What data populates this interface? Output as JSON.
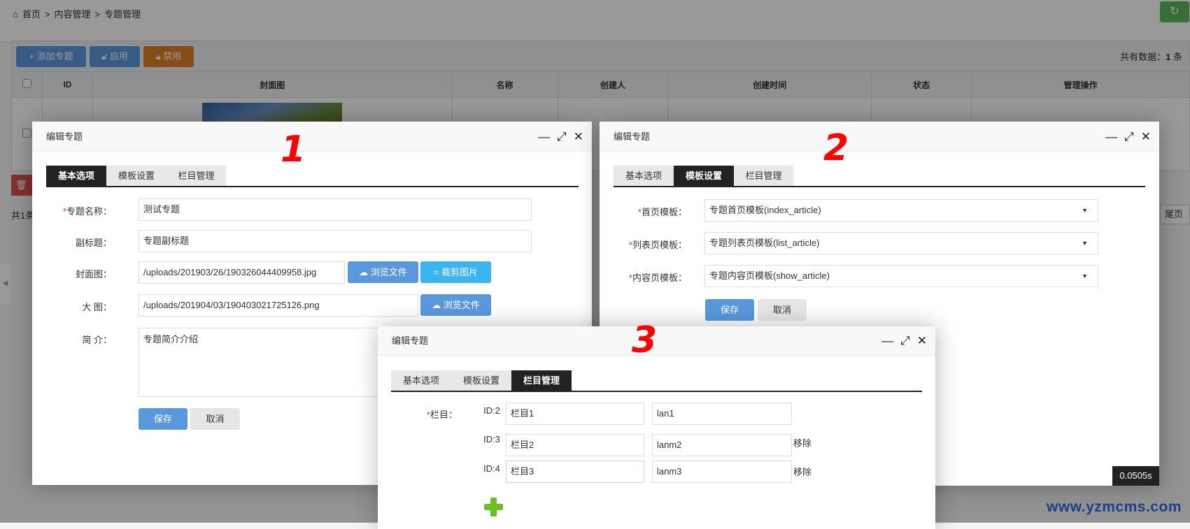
{
  "breadcrumb": [
    "首页",
    ">",
    "内容管理",
    ">",
    "专题管理"
  ],
  "toolbar": {
    "add": "添加专题",
    "enable": "启用",
    "disable": "禁用",
    "total_prefix": "共有数据：",
    "total_count": "1",
    "total_suffix": " 条"
  },
  "table": {
    "headers": [
      "ID",
      "封面图",
      "名称",
      "创建人",
      "创建时间",
      "状态",
      "管理操作"
    ]
  },
  "footer": {
    "count": "共1条",
    "last_page": "尾页",
    "timer": "0.0505s",
    "watermark": "www.yzmcms.com"
  },
  "colors": {
    "primary": "#5a98de",
    "warning": "#e17d25",
    "success": "#5cb85c",
    "danger": "#d9534f",
    "annotation": "#ff0000"
  },
  "annotations": [
    "1",
    "2",
    "3"
  ],
  "dialog_title": "编辑专题",
  "tabs": [
    "基本选项",
    "模板设置",
    "栏目管理"
  ],
  "dialog1": {
    "fields": [
      {
        "label": "专题名称：",
        "required": true,
        "value": "测试专题"
      },
      {
        "label": "副标题：",
        "value": "专题副标题"
      },
      {
        "label": "封面图：",
        "value": "/uploads/201903/26/190326044409958.jpg"
      },
      {
        "label": "大 图：",
        "value": "/uploads/201904/03/190403021725126.png"
      },
      {
        "label": "简 介：",
        "value": "专题简介介绍"
      }
    ],
    "browse": "浏览文件",
    "crop": "裁剪图片",
    "save": "保存",
    "cancel": "取消"
  },
  "dialog2": {
    "fields": [
      {
        "label": "首页模板：",
        "required": true,
        "value": "专题首页模板(index_article)"
      },
      {
        "label": "列表页模板：",
        "required": true,
        "value": "专题列表页模板(list_article)"
      },
      {
        "label": "内容页模板：",
        "required": true,
        "value": "专题内容页模板(show_article)"
      }
    ],
    "save": "保存",
    "cancel": "取消"
  },
  "dialog3": {
    "label": "栏目：",
    "rows": [
      {
        "id": "ID:2",
        "name": "栏目1",
        "alias": "lan1",
        "remove": ""
      },
      {
        "id": "ID:3",
        "name": "栏目2",
        "alias": "lanm2",
        "remove": "移除"
      },
      {
        "id": "ID:4",
        "name": "栏目3",
        "alias": "lanm3",
        "remove": "移除"
      }
    ]
  }
}
